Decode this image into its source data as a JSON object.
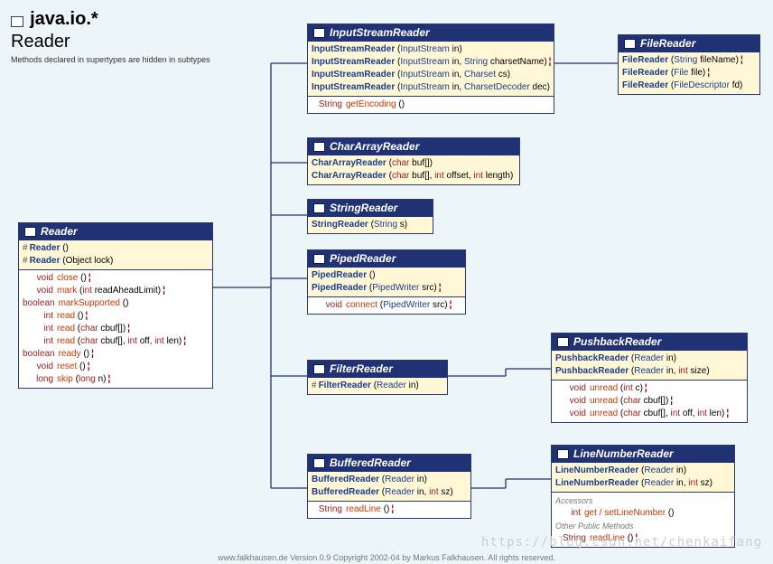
{
  "header": {
    "package": "java.io.*",
    "class": "Reader",
    "note": "Methods declared in supertypes are hidden in subtypes"
  },
  "boxes": {
    "Reader": {
      "title": "Reader",
      "constructors": [
        {
          "prot": "#",
          "name": "Reader",
          "params": "()"
        },
        {
          "prot": "#",
          "name": "Reader",
          "params": "(Object lock)"
        }
      ],
      "methods": [
        {
          "ret": "void",
          "name": "close",
          "params": "()",
          "t": true
        },
        {
          "ret": "void",
          "name": "mark",
          "params": "(int readAheadLimit)",
          "t": true
        },
        {
          "ret": "boolean",
          "name": "markSupported",
          "params": "()"
        },
        {
          "ret": "int",
          "name": "read",
          "params": "()",
          "t": true
        },
        {
          "ret": "int",
          "name": "read",
          "params": "(char cbuf[])",
          "t": true
        },
        {
          "ret": "int",
          "name": "read",
          "params": "(char cbuf[], int off, int len)",
          "t": true
        },
        {
          "ret": "boolean",
          "name": "ready",
          "params": "()",
          "t": true
        },
        {
          "ret": "void",
          "name": "reset",
          "params": "()",
          "t": true
        },
        {
          "ret": "long",
          "name": "skip",
          "params": "(long n)",
          "t": true
        }
      ]
    },
    "InputStreamReader": {
      "title": "InputStreamReader",
      "constructors": [
        {
          "name": "InputStreamReader",
          "params_html": "(<span class='typ2'>InputStream</span> in)"
        },
        {
          "name": "InputStreamReader",
          "params_html": "(<span class='typ2'>InputStream</span> in, <span class='typ2'>String</span> charsetName)",
          "t": true
        },
        {
          "name": "InputStreamReader",
          "params_html": "(<span class='typ2'>InputStream</span> in, <span class='typ2'>Charset</span> cs)"
        },
        {
          "name": "InputStreamReader",
          "params_html": "(<span class='typ2'>InputStream</span> in, <span class='typ2'>CharsetDecoder</span> dec)"
        }
      ],
      "methods": [
        {
          "ret": "String",
          "name": "getEncoding",
          "params": "()"
        }
      ]
    },
    "FileReader": {
      "title": "FileReader",
      "constructors": [
        {
          "name": "FileReader",
          "params_html": "(<span class='typ2'>String</span> fileName)",
          "t": true
        },
        {
          "name": "FileReader",
          "params_html": "(<span class='typ2'>File</span> file)",
          "t": true
        },
        {
          "name": "FileReader",
          "params_html": "(<span class='typ2'>FileDescriptor</span> fd)"
        }
      ]
    },
    "CharArrayReader": {
      "title": "CharArrayReader",
      "constructors": [
        {
          "name": "CharArrayReader",
          "params_html": "(<span class='kw'>char</span> buf[])"
        },
        {
          "name": "CharArrayReader",
          "params_html": "(<span class='kw'>char</span> buf[], <span class='kw'>int</span> offset, <span class='kw'>int</span> length)"
        }
      ]
    },
    "StringReader": {
      "title": "StringReader",
      "constructors": [
        {
          "name": "StringReader",
          "params_html": "(<span class='typ2'>String</span> s)"
        }
      ]
    },
    "PipedReader": {
      "title": "PipedReader",
      "constructors": [
        {
          "name": "PipedReader",
          "params_html": "()"
        },
        {
          "name": "PipedReader",
          "params_html": "(<span class='typ2'>PipedWriter</span> src)",
          "t": true
        }
      ],
      "methods": [
        {
          "ret": "void",
          "name": "connect",
          "params_html": "(<span class='typ2'>PipedWriter</span> src)",
          "t": true
        }
      ]
    },
    "FilterReader": {
      "title": "FilterReader",
      "constructors": [
        {
          "prot": "#",
          "name": "FilterReader",
          "params_html": "(<span class='typ2'>Reader</span> in)"
        }
      ]
    },
    "PushbackReader": {
      "title": "PushbackReader",
      "constructors": [
        {
          "name": "PushbackReader",
          "params_html": "(<span class='typ2'>Reader</span> in)"
        },
        {
          "name": "PushbackReader",
          "params_html": "(<span class='typ2'>Reader</span> in, <span class='kw'>int</span> size)"
        }
      ],
      "methods": [
        {
          "ret": "void",
          "name": "unread",
          "params_html": "(<span class='kw'>int</span> c)",
          "t": true
        },
        {
          "ret": "void",
          "name": "unread",
          "params_html": "(<span class='kw'>char</span> cbuf[])",
          "t": true
        },
        {
          "ret": "void",
          "name": "unread",
          "params_html": "(<span class='kw'>char</span> cbuf[], <span class='kw'>int</span> off, <span class='kw'>int</span> len)",
          "t": true
        }
      ]
    },
    "BufferedReader": {
      "title": "BufferedReader",
      "constructors": [
        {
          "name": "BufferedReader",
          "params_html": "(<span class='typ2'>Reader</span> in)"
        },
        {
          "name": "BufferedReader",
          "params_html": "(<span class='typ2'>Reader</span> in, <span class='kw'>int</span> sz)"
        }
      ],
      "methods": [
        {
          "ret": "String",
          "name": "readLine",
          "params": "()",
          "t": true
        }
      ]
    },
    "LineNumberReader": {
      "title": "LineNumberReader",
      "constructors": [
        {
          "name": "LineNumberReader",
          "params_html": "(<span class='typ2'>Reader</span> in)"
        },
        {
          "name": "LineNumberReader",
          "params_html": "(<span class='typ2'>Reader</span> in, <span class='kw'>int</span> sz)"
        }
      ],
      "accessors": [
        {
          "ret": "int",
          "names": "get / setLineNumber",
          "params": "()"
        }
      ],
      "sections": {
        "acc": "Accessors",
        "other": "Other Public Methods"
      },
      "methods": [
        {
          "ret": "String",
          "name": "readLine",
          "params": "()",
          "t": true
        }
      ]
    }
  },
  "footer": "www.falkhausen.de Version 0.9 Copyright 2002-04 by Markus Falkhausen. All rights reserved.",
  "watermark": "https://blog.csdn.net/chenkaifang"
}
